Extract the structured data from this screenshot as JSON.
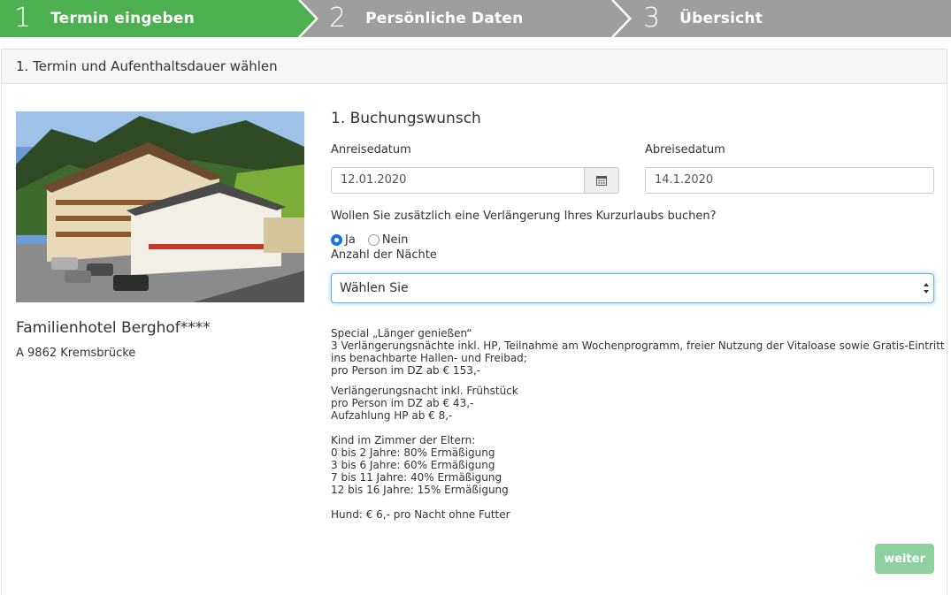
{
  "stepper": {
    "steps": [
      {
        "num": "1",
        "label": "Termin eingeben",
        "active": true
      },
      {
        "num": "2",
        "label": "Persönliche Daten",
        "active": false
      },
      {
        "num": "3",
        "label": "Übersicht",
        "active": false
      }
    ],
    "colors": {
      "active": "#4caf50",
      "inactive": "#9e9e9e"
    }
  },
  "panel": {
    "title": "1. Termin und Aufenthaltsdauer wählen"
  },
  "hotel": {
    "name": "Familienhotel Berghof****",
    "address": "A 9862 Kremsbrücke"
  },
  "booking": {
    "title": "1. Buchungswunsch",
    "arrival_label": "Anreisedatum",
    "arrival_value": "12.01.2020",
    "departure_label": "Abreisedatum",
    "departure_value": "14.1.2020",
    "extension_question": "Wollen Sie zusätzlich eine Verlängerung Ihres Kurzurlaubs buchen?",
    "radio_yes": "Ja",
    "radio_no": "Nein",
    "radio_selected": "Ja",
    "nights_label": "Anzahl der Nächte",
    "nights_select_value": "Wählen Sie"
  },
  "info": {
    "special": [
      "Special „Länger genießen“",
      "3 Verlängerungsnächte inkl. HP, Teilnahme am Wochenprogramm, freier Nutzung der Vitaloase sowie Gratis-Eintritt",
      "ins benachbarte Hallen- und Freibad;",
      "pro Person im DZ ab € 153,-"
    ],
    "night": [
      "Verlängerungsnacht inkl. Frühstück",
      "pro Person im DZ ab € 43,-",
      "Aufzahlung HP ab € 8,-"
    ],
    "kids": [
      "Kind im Zimmer der Eltern:",
      "0 bis 2 Jahre: 80% Ermäßigung",
      "3 bis 6 Jahre: 60% Ermäßigung",
      "7 bis 11 Jahre: 40% Ermäßigung",
      "12 bis 16 Jahre: 15% Ermäßigung"
    ],
    "dog": "Hund: € 6,- pro Nacht ohne Futter"
  },
  "actions": {
    "next_label": "weiter"
  }
}
